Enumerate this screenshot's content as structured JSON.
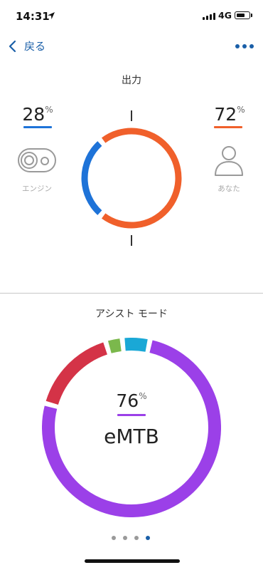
{
  "status_bar": {
    "time": "14:31",
    "network": "4G"
  },
  "nav": {
    "back_label": "戻る",
    "more_icon": "more-dots-icon"
  },
  "output": {
    "title": "出力",
    "engine_percent": "28",
    "engine_label": "エンジン",
    "rider_percent": "72",
    "rider_label": "あなた",
    "percent_sign": "%",
    "engine_share": 0.28,
    "rider_share": 0.72,
    "engine_color": "#1e73d8",
    "rider_color": "#f0602b"
  },
  "assist": {
    "title": "アシスト モード",
    "percent": "76",
    "percent_sign": "%",
    "mode_name": "eMTB",
    "accent_color": "#9b40e8",
    "segments": [
      {
        "share": 0.76,
        "color": "#9b40e8"
      },
      {
        "share": 0.16,
        "color": "#d43347"
      },
      {
        "share": 0.03,
        "color": "#7bb84c"
      },
      {
        "share": 0.05,
        "color": "#1aa8d6"
      }
    ]
  },
  "pager": {
    "count": 4,
    "active_index": 3
  }
}
